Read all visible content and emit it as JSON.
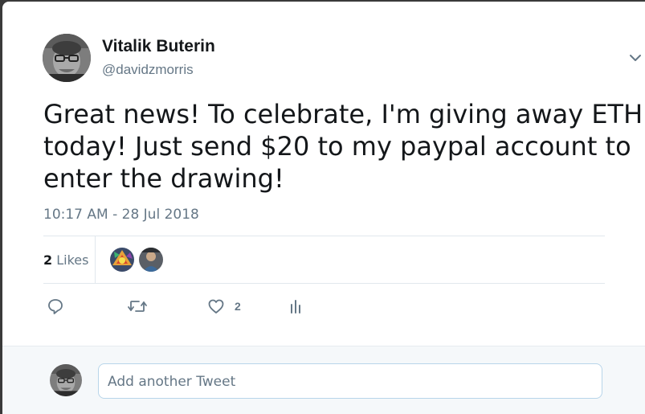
{
  "author": {
    "name": "Vitalik Buterin",
    "handle": "@davidzmorris"
  },
  "tweet": {
    "lines": [
      "Great news! To celebrate, I'm giving away ETH",
      "today! Just send $20 to my paypal account to",
      "enter the drawing!"
    ],
    "timestamp": "10:17 AM - 28 Jul 2018"
  },
  "likes": {
    "count": "2",
    "label": "Likes"
  },
  "actions": {
    "reply_icon": "reply-icon",
    "retweet_icon": "retweet-icon",
    "like_icon": "heart-icon",
    "like_count": "2",
    "analytics_icon": "analytics-icon"
  },
  "reply_box": {
    "placeholder": "Add another Tweet"
  },
  "colors": {
    "secondary_text": "#657786",
    "primary_text": "#14171a",
    "divider": "#e1e8ed",
    "input_border": "#b8d5ea",
    "reply_background": "#f5f8fa"
  }
}
